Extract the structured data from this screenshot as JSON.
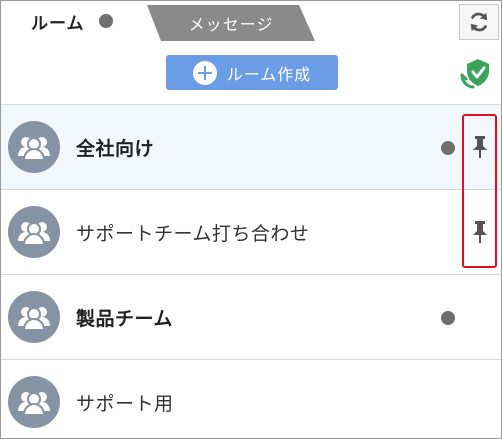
{
  "tabs": {
    "rooms_label": "ルーム",
    "messages_label": "メッセージ"
  },
  "toolbar": {
    "create_room_label": "ルーム作成"
  },
  "rooms": [
    {
      "name": "全社向け",
      "bold": true,
      "unread": true,
      "pinned": true
    },
    {
      "name": "サポートチーム打ち合わせ",
      "bold": false,
      "unread": false,
      "pinned": true
    },
    {
      "name": "製品チーム",
      "bold": true,
      "unread": true,
      "pinned": false
    },
    {
      "name": "サポート用",
      "bold": false,
      "unread": false,
      "pinned": false
    }
  ],
  "colors": {
    "accent": "#6b9ce6",
    "avatar": "#8593a5",
    "unread_dot": "#6f6f6f",
    "highlight_box": "#e0101c",
    "shield": "#3aa55a"
  }
}
